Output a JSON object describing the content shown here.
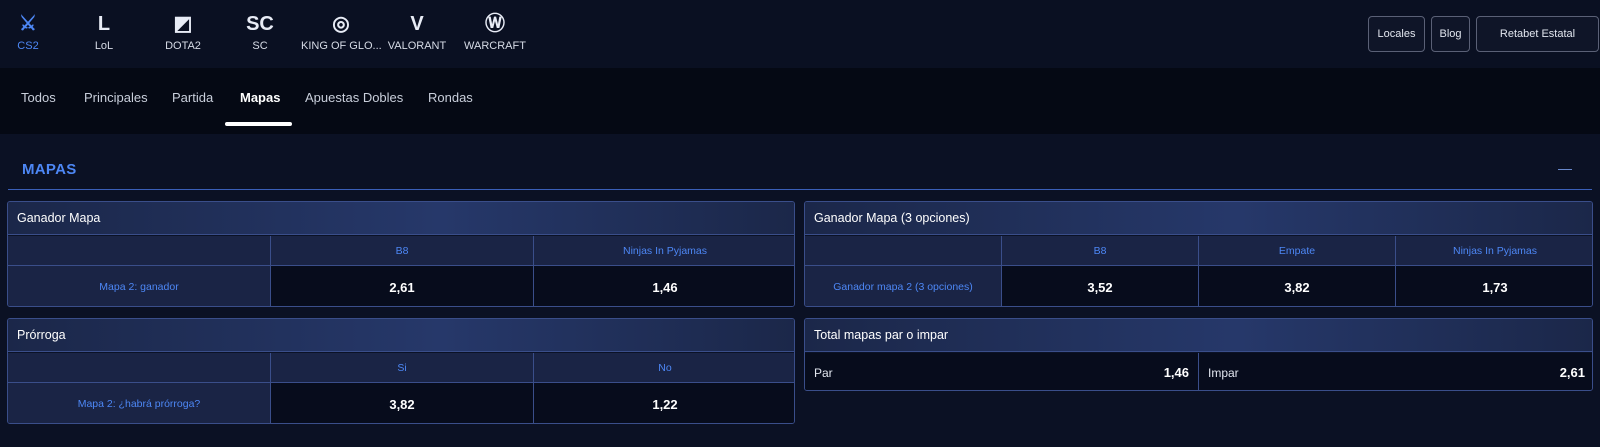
{
  "games": [
    {
      "icon": "counter-strike-icon",
      "glyph": "⚔",
      "label": "CS2",
      "active": true
    },
    {
      "icon": "league-of-legends-icon",
      "glyph": "L",
      "label": "LoL"
    },
    {
      "icon": "dota2-icon",
      "glyph": "◩",
      "label": "DOTA2"
    },
    {
      "icon": "starcraft-icon",
      "glyph": "SC",
      "label": "SC"
    },
    {
      "icon": "king-of-glory-icon",
      "glyph": "◎",
      "label": "KING OF GLO..."
    },
    {
      "icon": "valorant-icon",
      "glyph": "V",
      "label": "VALORANT"
    },
    {
      "icon": "warcraft-icon",
      "glyph": "Ⓦ",
      "label": "WARCRAFT"
    }
  ],
  "top_buttons": {
    "locales": "Locales",
    "blog": "Blog",
    "estatal": "Retabet Estatal"
  },
  "tabs": [
    "Todos",
    "Principales",
    "Partida",
    "Mapas",
    "Apuestas Dobles",
    "Rondas"
  ],
  "active_tab": "Mapas",
  "section": {
    "title": "MAPAS",
    "collapse": "—"
  },
  "markets": {
    "ganador_mapa": {
      "title": "Ganador Mapa",
      "cols": [
        "B8",
        "Ninjas In Pyjamas"
      ],
      "row_label": "Mapa 2: ganador",
      "odds": [
        "2,61",
        "1,46"
      ]
    },
    "ganador_mapa_3": {
      "title": "Ganador Mapa (3 opciones)",
      "cols": [
        "B8",
        "Empate",
        "Ninjas In Pyjamas"
      ],
      "row_label": "Ganador mapa 2 (3 opciones)",
      "odds": [
        "3,52",
        "3,82",
        "1,73"
      ]
    },
    "prorroga": {
      "title": "Prórroga",
      "cols": [
        "Si",
        "No"
      ],
      "row_label": "Mapa 2: ¿habrá prórroga?",
      "odds": [
        "3,82",
        "1,22"
      ]
    },
    "total_mapas": {
      "title": "Total mapas par o impar",
      "options": [
        {
          "label": "Par",
          "odd": "1,46"
        },
        {
          "label": "Impar",
          "odd": "2,61"
        }
      ]
    }
  }
}
